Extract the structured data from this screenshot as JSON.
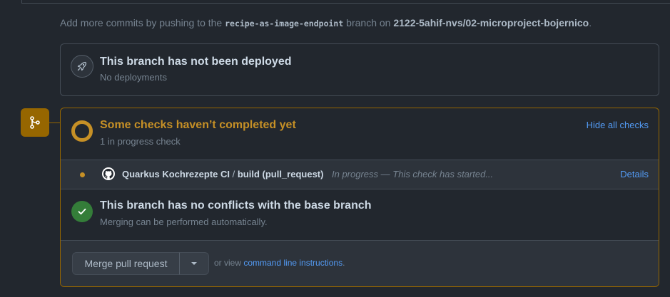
{
  "commit_hint": {
    "prefix": "Add more commits by pushing to the ",
    "branch": "recipe-as-image-endpoint",
    "middle": " branch on ",
    "repo": "2122-5ahif-nvs/02-microproject-bojernico",
    "suffix": "."
  },
  "deployment": {
    "title": "This branch has not been deployed",
    "subtitle": "No deployments",
    "icon": "rocket-icon"
  },
  "checks": {
    "title": "Some checks haven’t completed yet",
    "subtitle": "1 in progress check",
    "hide_link": "Hide all checks",
    "status_color": "#c69026",
    "items": [
      {
        "workflow": "Quarkus Kochrezepte CI",
        "separator": " / ",
        "job": "build (pull_request)",
        "status": "In progress — This check has started...",
        "details": "Details"
      }
    ]
  },
  "conflicts": {
    "title": "This branch has no conflicts with the base branch",
    "subtitle": "Merging can be performed automatically.",
    "status_color": "#347d39"
  },
  "merge": {
    "button_label": "Merge pull request",
    "view_prefix": "or view ",
    "view_link": "command line instructions",
    "view_suffix": "."
  }
}
